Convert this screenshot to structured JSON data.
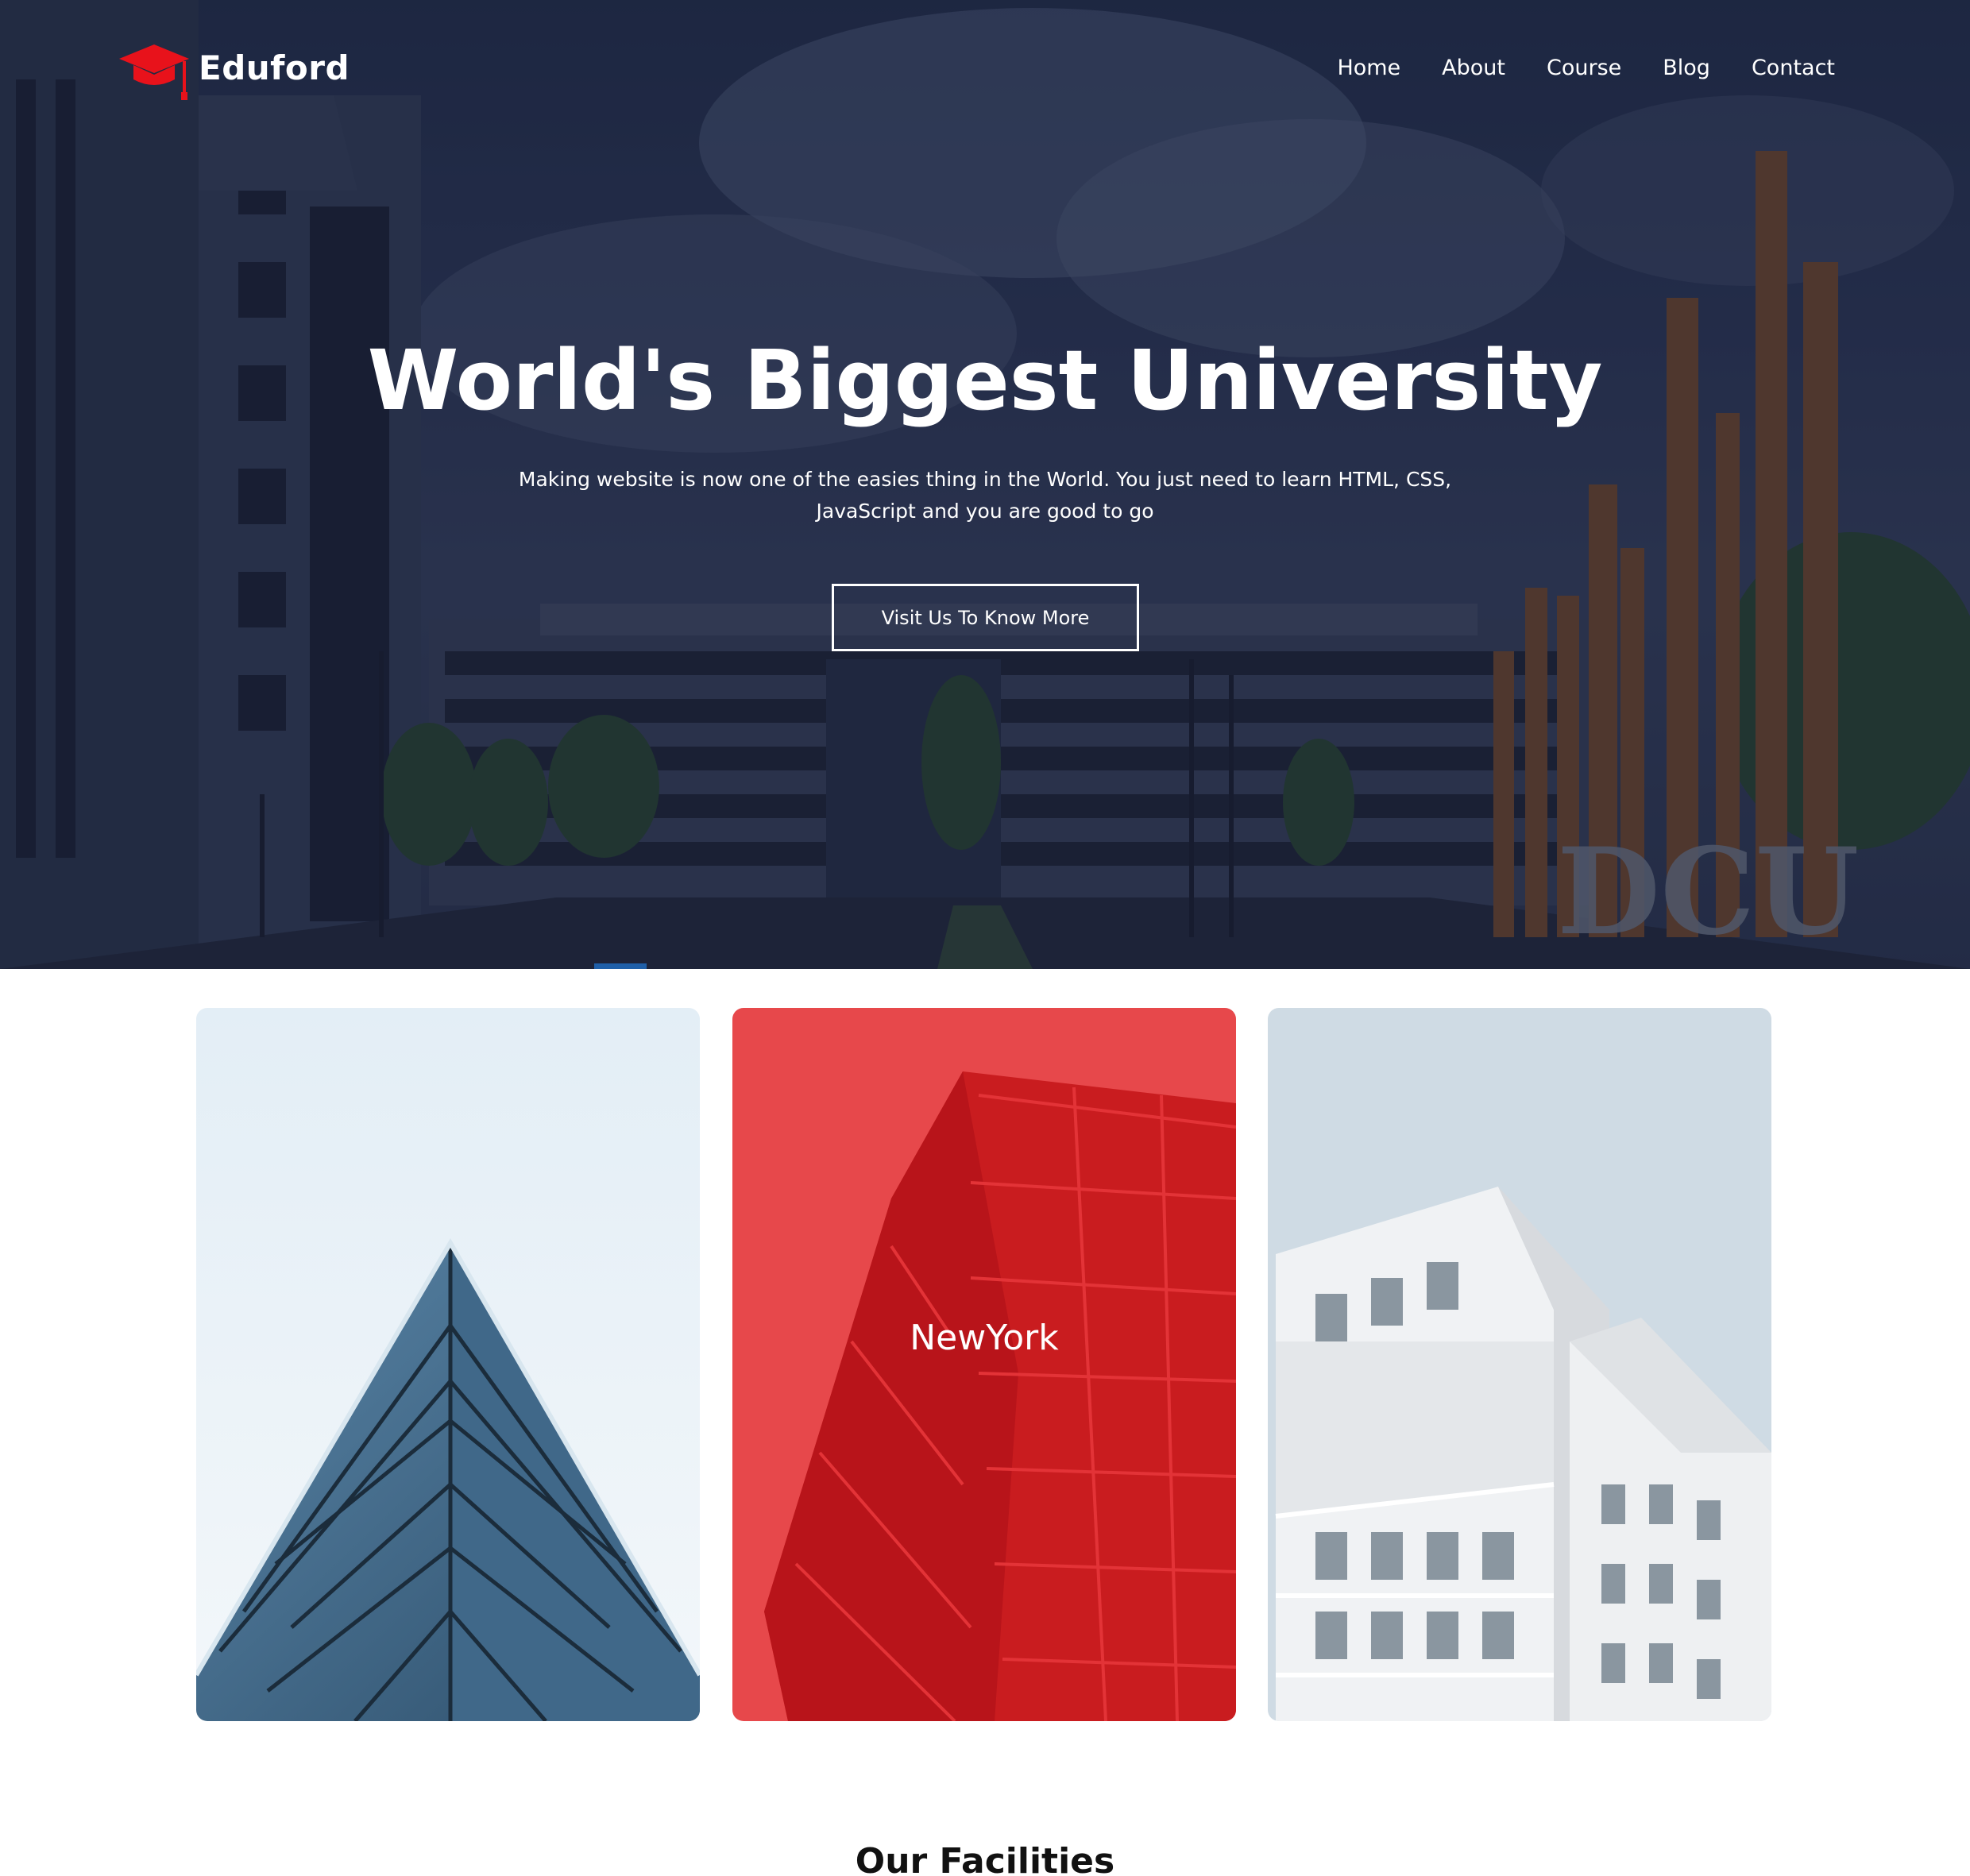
{
  "brand": {
    "name": "Eduford",
    "icon": "graduation-cap-icon",
    "accent": "#e8121b"
  },
  "nav": {
    "items": [
      {
        "label": "Home"
      },
      {
        "label": "About"
      },
      {
        "label": "Course"
      },
      {
        "label": "Blog"
      },
      {
        "label": "Contact"
      }
    ]
  },
  "hero": {
    "title": "World's Biggest University",
    "subtitle_line1": "Making website is now one of the easies thing in the World. You just need to learn HTML, CSS,",
    "subtitle_line2": "JavaScript and you are good to go",
    "button_label": "Visit Us To Know More",
    "sign_text": "DCU"
  },
  "campus": {
    "cards": [
      {
        "label": ""
      },
      {
        "label": "NewYork",
        "overlay_color": "#e8121b"
      },
      {
        "label": ""
      }
    ]
  },
  "facilities": {
    "title": "Our Facilities"
  }
}
